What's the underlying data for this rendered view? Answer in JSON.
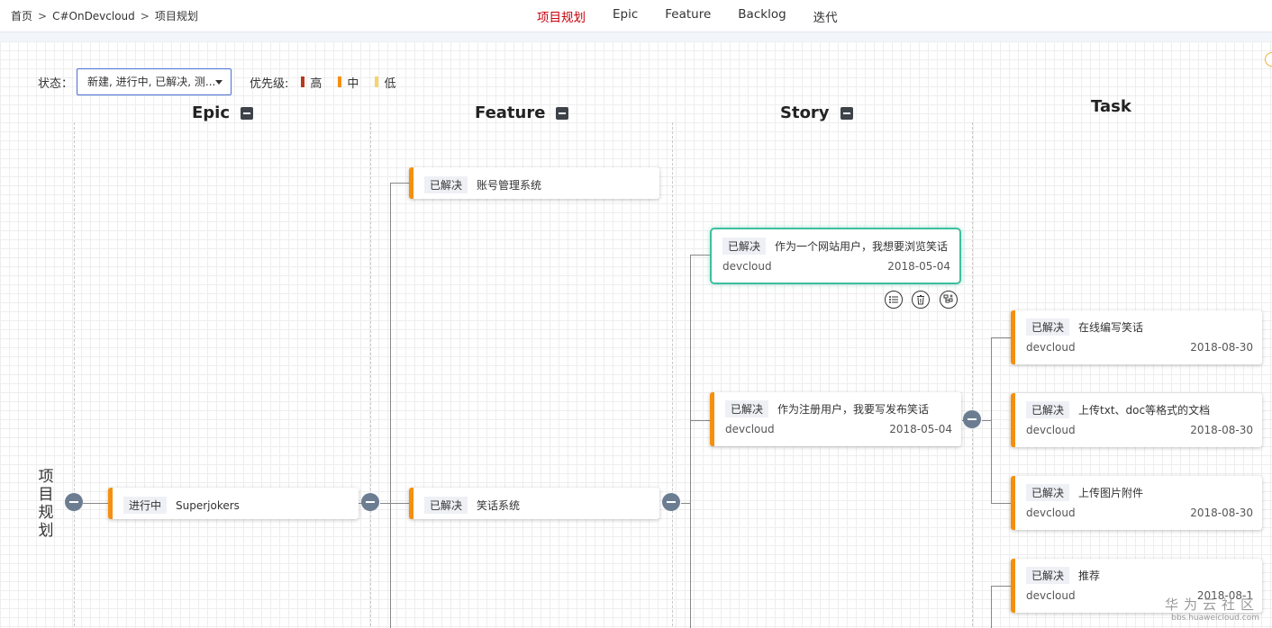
{
  "breadcrumb": {
    "items": [
      "首页",
      "C#OnDevcloud",
      "项目规划"
    ],
    "separator": ">"
  },
  "nav": {
    "tabs": [
      "项目规划",
      "Epic",
      "Feature",
      "Backlog",
      "迭代"
    ],
    "active": "项目规划",
    "active_color": "#c7000b"
  },
  "filters": {
    "status_label": "状态：",
    "status_value": "新建, 进行中, 已解决, 测...",
    "priority_label": "优先级:",
    "priorities": [
      {
        "label": "高",
        "color": "#b83a1c"
      },
      {
        "label": "中",
        "color": "#f5900f"
      },
      {
        "label": "低",
        "color": "#f7d36b"
      }
    ]
  },
  "columns": {
    "epic": "Epic",
    "feature": "Feature",
    "story": "Story",
    "task": "Task"
  },
  "root": {
    "title": "项目规划"
  },
  "cards": {
    "epic_1": {
      "status": "进行中",
      "title": "Superjokers"
    },
    "feature_1": {
      "status": "已解决",
      "title": "账号管理系统"
    },
    "feature_2": {
      "status": "已解决",
      "title": "笑话系统"
    },
    "story_1": {
      "status": "已解决",
      "title": "作为一个网站用户，我想要浏览笑话",
      "owner": "devcloud",
      "date": "2018-05-04"
    },
    "story_2": {
      "status": "已解决",
      "title": "作为注册用户，我要写发布笑话",
      "owner": "devcloud",
      "date": "2018-05-04"
    },
    "task_1": {
      "status": "已解决",
      "title": "在线编写笑话",
      "owner": "devcloud",
      "date": "2018-08-30"
    },
    "task_2": {
      "status": "已解决",
      "title": "上传txt、doc等格式的文档",
      "owner": "devcloud",
      "date": "2018-08-30"
    },
    "task_3": {
      "status": "已解决",
      "title": "上传图片附件",
      "owner": "devcloud",
      "date": "2018-08-30"
    },
    "task_4": {
      "status": "已解决",
      "title": "推荐",
      "owner": "devcloud",
      "date": "2018-08-1"
    }
  },
  "card_actions": [
    "list-icon",
    "trash-icon",
    "add-child-icon"
  ],
  "watermark": {
    "text": "华为云社区",
    "url": "bbs.huaweicloud.com"
  },
  "colors": {
    "card_accent": "#f5900f",
    "selected_border": "#3fbf9f",
    "collapse_button": "#6c7d92"
  }
}
